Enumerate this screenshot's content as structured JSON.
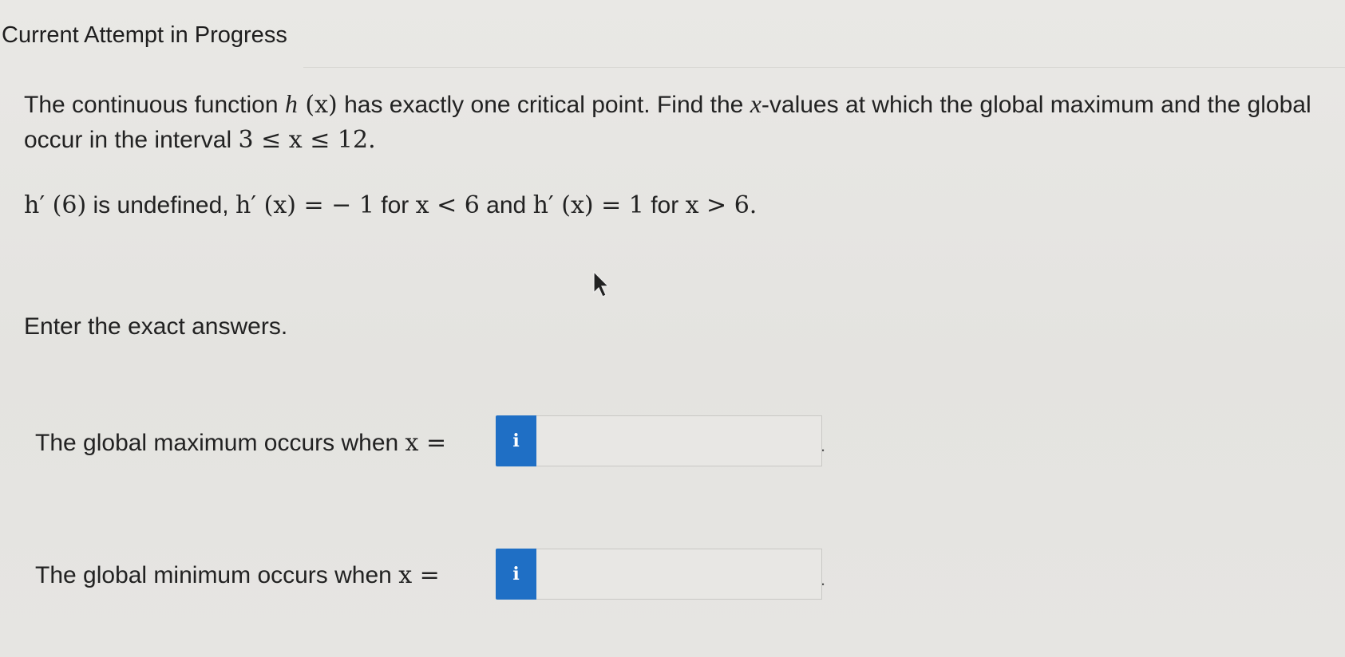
{
  "header": {
    "title": "Current Attempt in Progress"
  },
  "question": {
    "line1": {
      "part1": "The continuous function ",
      "func": "h",
      "paren": " (x)",
      "part2": " has exactly one critical point. Find the ",
      "var": "x",
      "part3": "-values at which the global maximum and the global"
    },
    "line2": {
      "part1": "occur in the interval ",
      "interval": "3 ≤ x ≤ 12."
    },
    "line3": {
      "hprime6": "h′ (6)",
      "part1": " is undefined, ",
      "cond1": "h′ (x) = − 1",
      "part2": " for ",
      "cond2": "x < 6",
      "part3": " and ",
      "cond3": "h′ (x) = 1",
      "part4": " for ",
      "cond4": "x > 6."
    },
    "instruction": "Enter the exact answers."
  },
  "answers": {
    "max": {
      "label_text": "The global maximum occurs when ",
      "label_math": "x =",
      "info_glyph": "i",
      "value": "",
      "suffix": "."
    },
    "min": {
      "label_text": "The global minimum occurs when ",
      "label_math": "x =",
      "info_glyph": "i",
      "value": "",
      "suffix": "."
    }
  },
  "icons": {
    "cursor": "mouse-pointer-icon",
    "info": "info-icon"
  },
  "colors": {
    "info_button": "#1f6fc5",
    "background": "#e7e6e3"
  }
}
